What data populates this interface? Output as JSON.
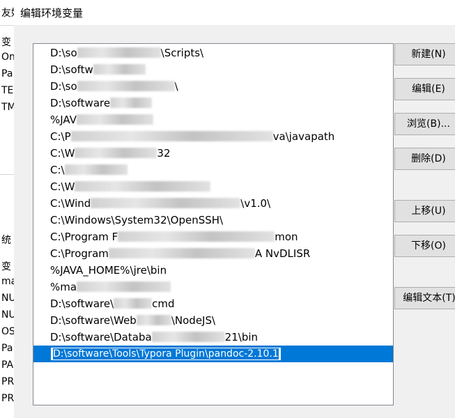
{
  "dialog": {
    "title": "编辑环境变量"
  },
  "background_window": {
    "lines_top": [
      "友好",
      "变",
      "On",
      "Pa",
      "TE",
      "TM"
    ],
    "lines_bottom": [
      "统",
      "变",
      "ma",
      "NU",
      "NU",
      "OS",
      "Pa",
      "PA",
      "PR",
      "PR"
    ]
  },
  "path_list": {
    "items": [
      {
        "pre": "D:\\so",
        "post": "\\Scripts\\"
      },
      {
        "pre": "D:\\softw",
        "post": ""
      },
      {
        "pre": "D:\\so",
        "post": "\\"
      },
      {
        "pre": "D:\\software",
        "post": ""
      },
      {
        "pre": "%JAV",
        "post": ""
      },
      {
        "pre": "C:\\P",
        "post": "va\\javapath"
      },
      {
        "pre": "C:\\W",
        "post": "32"
      },
      {
        "pre": "C:\\",
        "post": ""
      },
      {
        "pre": "C:\\W",
        "post": ""
      },
      {
        "pre": "C:\\Wind",
        "post": "\\v1.0\\"
      },
      {
        "pre": "C:\\Windows\\System32\\OpenSSH\\",
        "post": ""
      },
      {
        "pre": "C:\\Program F",
        "post": "mon"
      },
      {
        "pre": "C:\\Program",
        "post": "A NvDLISR"
      },
      {
        "pre": "%JAVA_HOME%\\jre\\bin",
        "post": ""
      },
      {
        "pre": "%ma",
        "post": ""
      },
      {
        "pre": "D:\\software\\",
        "post": "cmd"
      },
      {
        "pre": "D:\\software\\Web",
        "post": "\\NodeJS\\"
      },
      {
        "pre": "D:\\software\\Databa",
        "post": "21\\bin"
      }
    ],
    "selected_edit_value": "D:\\software\\Tools\\Typora Plugin\\pandoc-2.10.1"
  },
  "buttons": {
    "new": "新建(N)",
    "edit": "编辑(E)",
    "browse": "浏览(B)...",
    "delete": "删除(D)",
    "move_up": "上移(U)",
    "move_down": "下移(O)",
    "edit_text": "编辑文本(T)"
  }
}
